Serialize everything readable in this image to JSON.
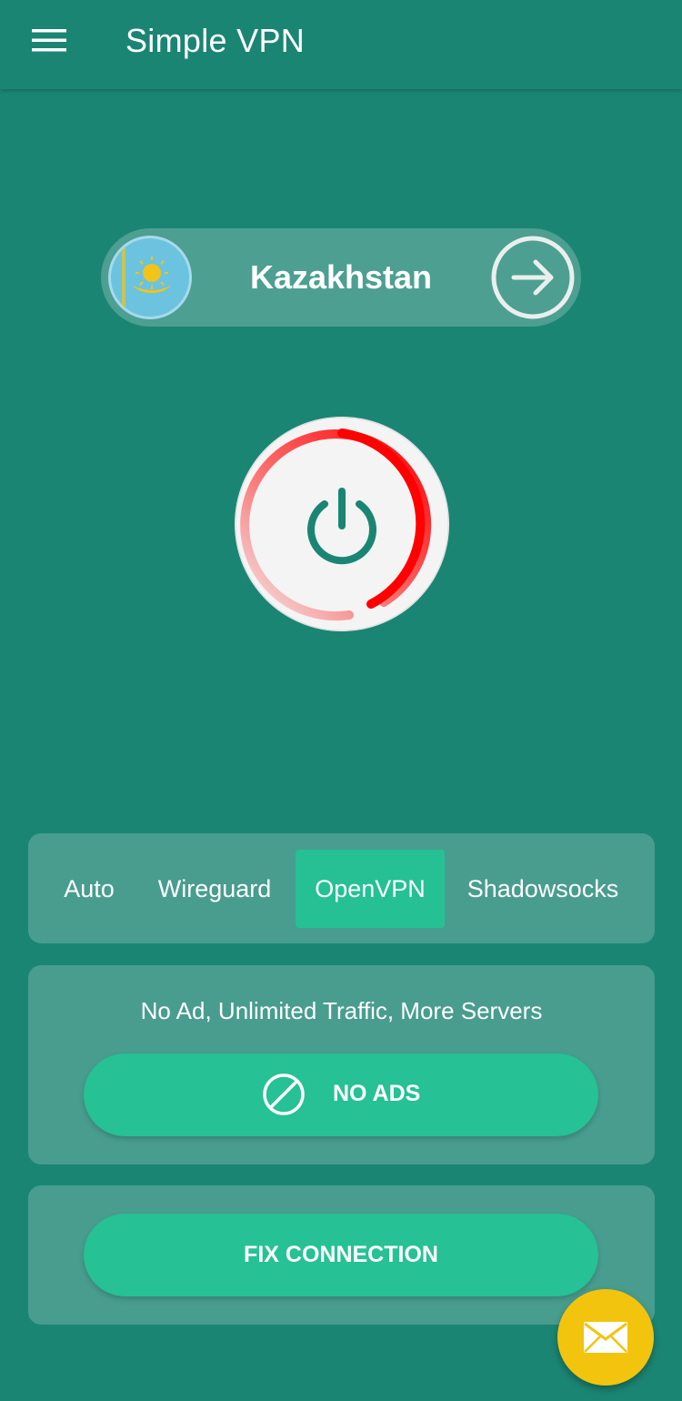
{
  "app": {
    "title": "Simple VPN"
  },
  "icons": {
    "menu": "menu-icon",
    "flag": "kazakhstan-flag-icon",
    "arrow": "arrow-right-icon",
    "power": "power-icon",
    "no_ads": "block-icon",
    "mail": "mail-icon"
  },
  "server": {
    "country": "Kazakhstan"
  },
  "connection": {
    "progress_arc_color": "#ff0000",
    "state": "connecting"
  },
  "protocols": {
    "selected": "OpenVPN",
    "tabs": [
      {
        "label": "Auto"
      },
      {
        "label": "Wireguard"
      },
      {
        "label": "OpenVPN"
      },
      {
        "label": "Shadowsocks"
      }
    ]
  },
  "promo": {
    "text": "No Ad, Unlimited Traffic, More Servers",
    "button_label": "NO ADS"
  },
  "fix": {
    "button_label": "FIX CONNECTION"
  },
  "colors": {
    "background": "#1b8573",
    "accent": "#25c194",
    "fab": "#f2c40e"
  }
}
